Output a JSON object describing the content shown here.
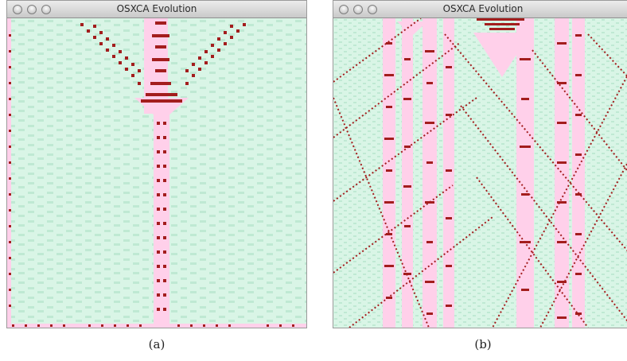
{
  "windows": [
    {
      "title": "OSXCA Evolution",
      "caption": "(a)"
    },
    {
      "title": "OSXCA Evolution",
      "caption": "(b)"
    }
  ],
  "colors": {
    "background": "#d9f5e6",
    "texture": "#bfe9d3",
    "particle": "#a31d1d",
    "glider_band": "#ffd0ea"
  }
}
